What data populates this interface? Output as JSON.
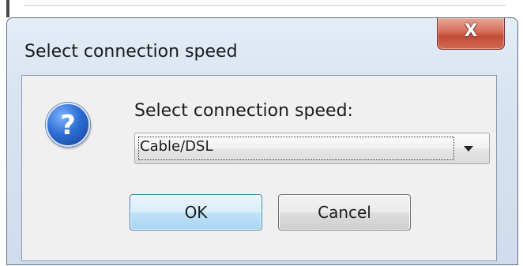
{
  "window": {
    "title": "Select connection speed",
    "close_glyph": "X"
  },
  "dialog": {
    "icon": "question-icon",
    "icon_glyph": "?",
    "prompt": "Select connection speed:",
    "speed_select": {
      "selected_value": "Cable/DSL"
    },
    "ok_label": "OK",
    "cancel_label": "Cancel"
  },
  "colors": {
    "close_button": "#c44c36",
    "ok_button_border": "#3c7fb1",
    "icon_blue": "#2d6fd6"
  }
}
